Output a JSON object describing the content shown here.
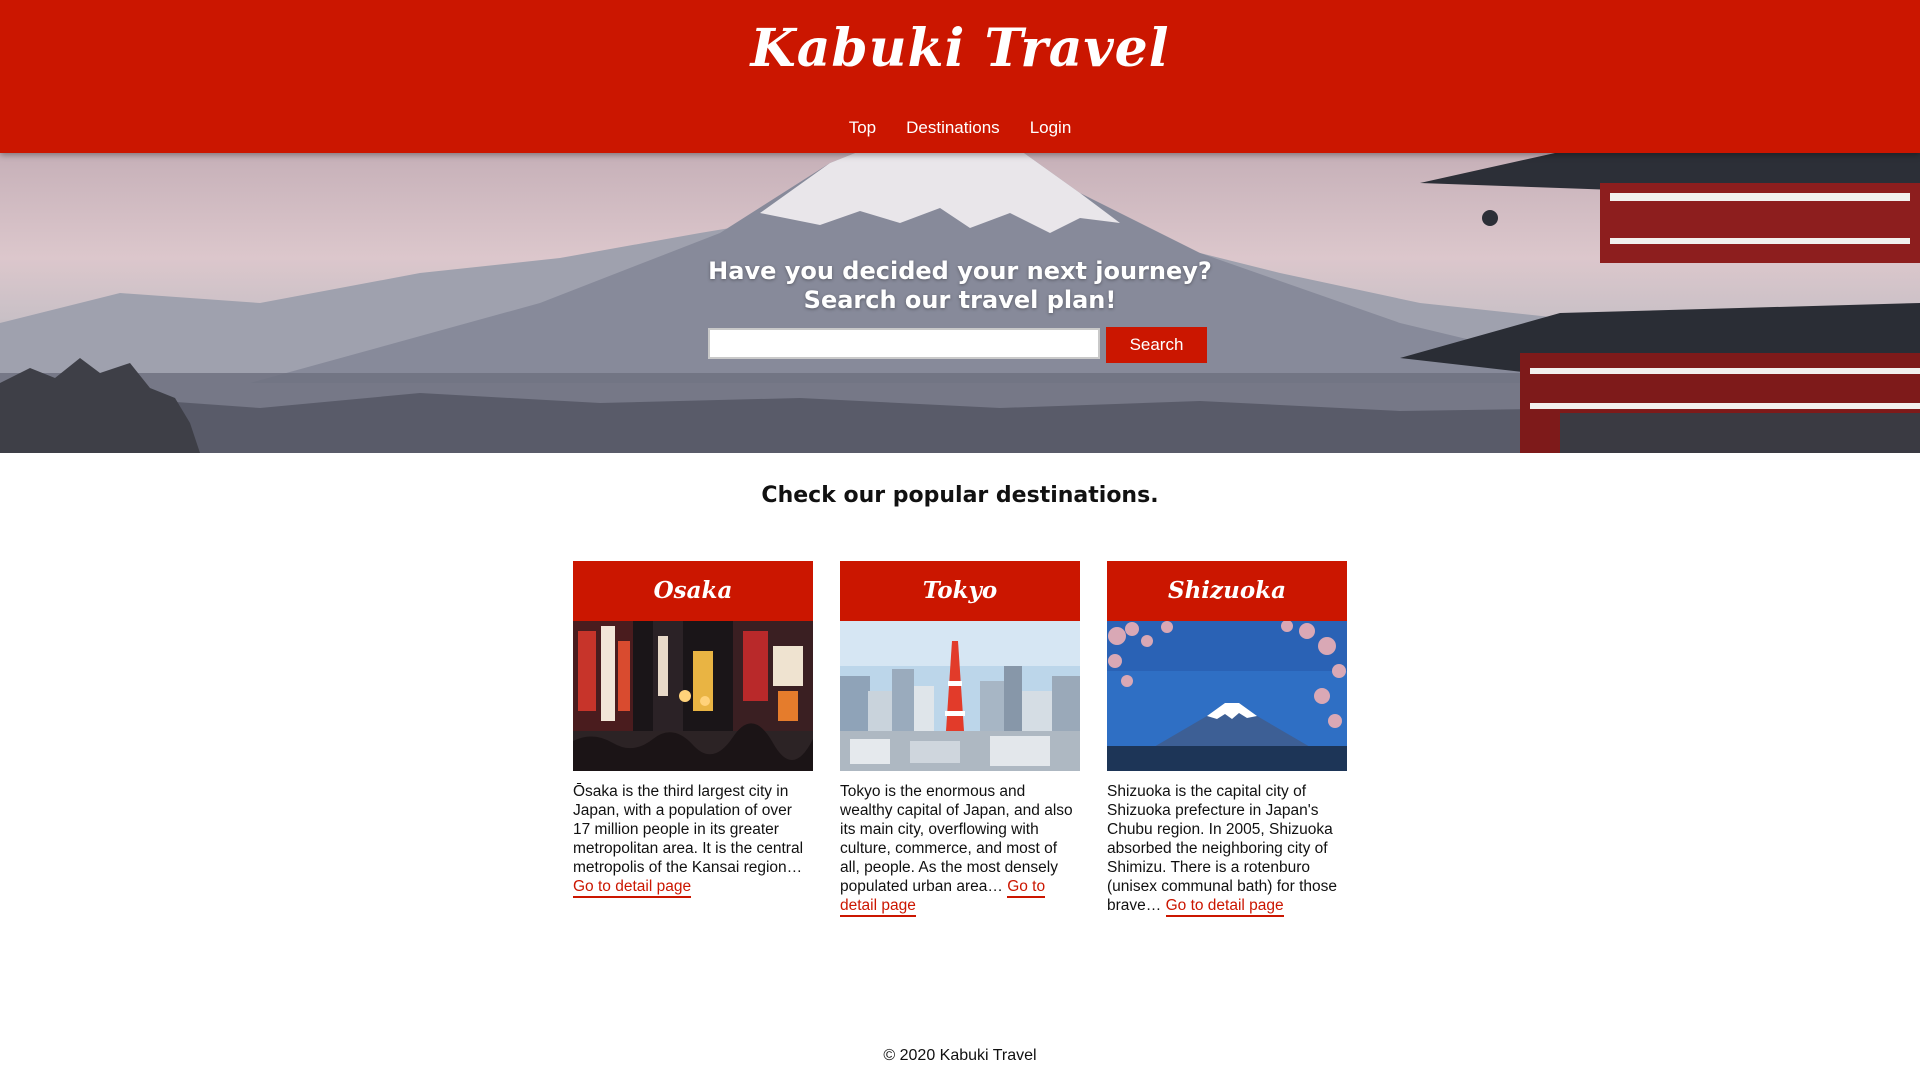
{
  "header": {
    "title": "Kabuki Travel",
    "nav": [
      "Top",
      "Destinations",
      "Login"
    ]
  },
  "hero": {
    "heading_line1": "Have you decided your next journey?",
    "heading_line2": "Search our travel plan!",
    "search_value": "",
    "search_placeholder": "",
    "search_button": "Search"
  },
  "destinations": {
    "heading": "Check our popular destinations.",
    "link_label": "Go to detail page",
    "cards": [
      {
        "title": "Osaka",
        "text": "Ōsaka is the third largest city in Japan, with a population of over 17 million people in its greater metropolitan area. It is the central metropolis of the Kansai region…",
        "image": "osaka-night-street"
      },
      {
        "title": "Tokyo",
        "text": "Tokyo is the enormous and wealthy capital of Japan, and also its main city, overflowing with culture, commerce, and most of all, people. As the most densely populated urban area…",
        "image": "tokyo-tower-skyline"
      },
      {
        "title": "Shizuoka",
        "text": "Shizuoka is the capital city of Shizuoka prefecture in Japan's Chubu region. In 2005, Shizuoka absorbed the neighboring city of Shimizu. There is a rotenburo (unisex communal bath) for those brave…",
        "image": "mount-fuji-blossoms"
      }
    ]
  },
  "footer": {
    "text": "© 2020 Kabuki Travel"
  },
  "colors": {
    "brand_red": "#cb1600",
    "text": "#111111"
  }
}
